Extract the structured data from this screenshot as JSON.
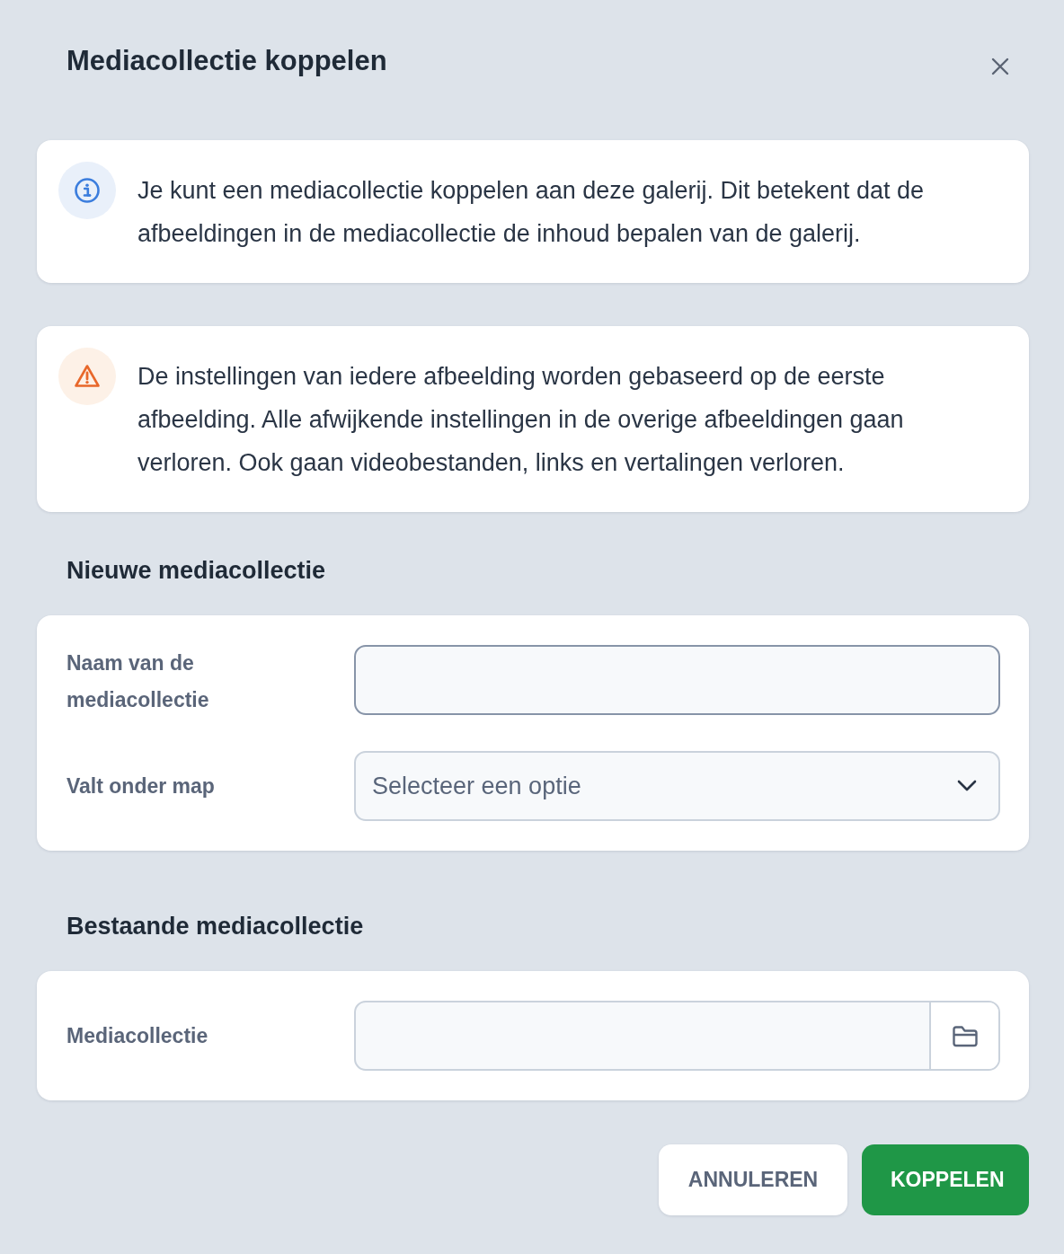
{
  "dialog": {
    "title": "Mediacollectie koppelen"
  },
  "notices": [
    {
      "kind": "info",
      "text": "Je kunt een mediacollectie koppelen aan deze galerij. Dit betekent dat de afbeeldingen in de mediacollectie de inhoud bepalen van de galerij."
    },
    {
      "kind": "warning",
      "text": "De instellingen van iedere afbeelding worden gebaseerd op de eerste afbeelding. Alle afwijkende instellingen in de overige afbeeldingen gaan verloren. Ook gaan videobestanden, links en vertalingen verloren."
    }
  ],
  "sections": [
    {
      "heading": "Nieuwe mediacollectie",
      "fields": [
        {
          "kind": "text",
          "label": "Naam van de mediacollectie",
          "focused": true
        },
        {
          "kind": "select",
          "label": "Valt onder map",
          "placeholder": "Selecteer een optie",
          "focused": false
        }
      ]
    },
    {
      "heading": "Bestaande mediacollectie",
      "fields": [
        {
          "kind": "picker",
          "label": "Mediacollectie",
          "focused": false
        }
      ]
    }
  ],
  "buttons": [
    {
      "kind": "secondary",
      "label": "ANNULEREN"
    },
    {
      "kind": "primary",
      "label": "KOPPELEN"
    }
  ]
}
